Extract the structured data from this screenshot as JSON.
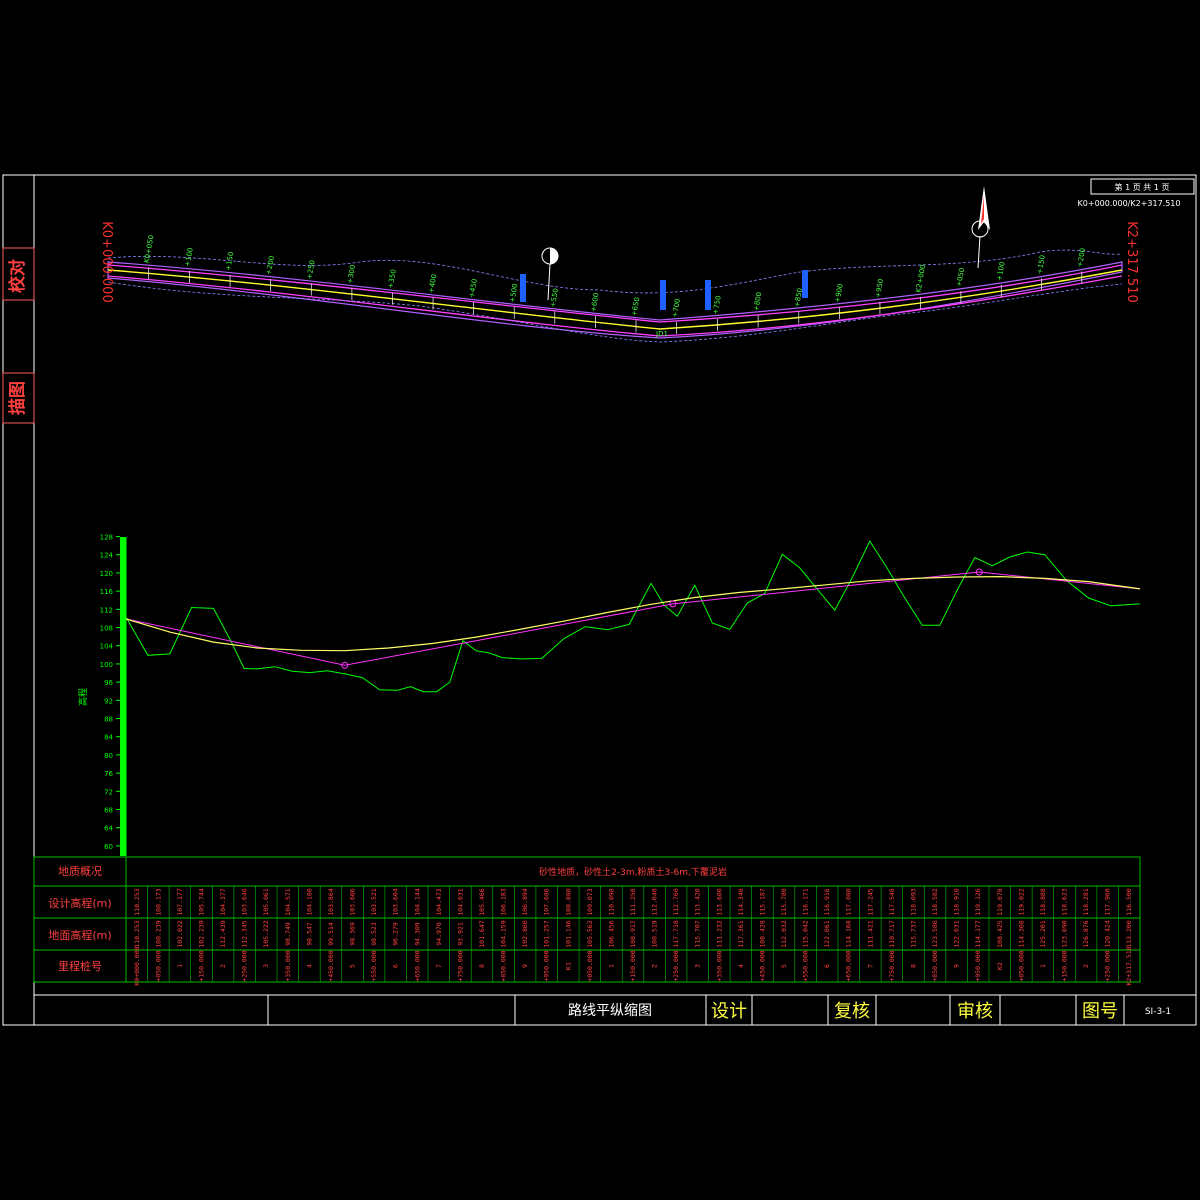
{
  "sidebar": {
    "check_label": "校对",
    "draw_label": "描图"
  },
  "header": {
    "page_info": "第 1 页 共 1 页",
    "station_range": "K0+000.000/K2+317.510"
  },
  "plan": {
    "start_label": "K0+000.000",
    "end_label": "K2+317.510",
    "curve_label": "JD1",
    "station_labels": [
      "K0+050",
      "+100",
      "+150",
      "+200",
      "+250",
      "+300",
      "+350",
      "+400",
      "+450",
      "+500",
      "+550",
      "+600",
      "+650",
      "+700",
      "+750",
      "+800",
      "+850",
      "+900",
      "+950",
      "K2+000",
      "+050",
      "+100",
      "+150",
      "+200"
    ]
  },
  "profile": {
    "axis_label": "高程",
    "y_ticks": [
      60,
      64,
      68,
      72,
      76,
      80,
      84,
      88,
      92,
      96,
      100,
      104,
      108,
      112,
      116,
      120,
      124,
      128
    ],
    "ylim": [
      58,
      129
    ],
    "xlim": [
      0,
      2317.51
    ],
    "ground": [
      [
        0,
        110.3
      ],
      [
        50,
        101.9
      ],
      [
        100,
        102.2
      ],
      [
        150,
        112.4
      ],
      [
        200,
        112.2
      ],
      [
        240,
        105
      ],
      [
        270,
        99
      ],
      [
        300,
        98.9
      ],
      [
        340,
        99.4
      ],
      [
        380,
        98.4
      ],
      [
        420,
        98.1
      ],
      [
        460,
        98.5
      ],
      [
        500,
        97.8
      ],
      [
        540,
        97
      ],
      [
        580,
        94.3
      ],
      [
        620,
        94.2
      ],
      [
        650,
        95
      ],
      [
        680,
        93.9
      ],
      [
        710,
        93.9
      ],
      [
        740,
        96
      ],
      [
        770,
        105.1
      ],
      [
        800,
        102.9
      ],
      [
        830,
        102.4
      ],
      [
        860,
        101.4
      ],
      [
        900,
        101.1
      ],
      [
        950,
        101.2
      ],
      [
        1000,
        105.5
      ],
      [
        1050,
        108.2
      ],
      [
        1100,
        107.5
      ],
      [
        1150,
        108.7
      ],
      [
        1200,
        117.7
      ],
      [
        1230,
        112.9
      ],
      [
        1260,
        110.5
      ],
      [
        1300,
        117.3
      ],
      [
        1340,
        109
      ],
      [
        1380,
        107.6
      ],
      [
        1420,
        113.4
      ],
      [
        1460,
        115.5
      ],
      [
        1500,
        124.1
      ],
      [
        1540,
        121.1
      ],
      [
        1580,
        116.4
      ],
      [
        1620,
        111.8
      ],
      [
        1660,
        119
      ],
      [
        1700,
        127
      ],
      [
        1740,
        121
      ],
      [
        1780,
        114.5
      ],
      [
        1820,
        108.5
      ],
      [
        1860,
        108.5
      ],
      [
        1900,
        116.3
      ],
      [
        1940,
        123.4
      ],
      [
        1980,
        121.6
      ],
      [
        2020,
        123.5
      ],
      [
        2060,
        124.6
      ],
      [
        2100,
        124
      ],
      [
        2150,
        118.3
      ],
      [
        2200,
        114.5
      ],
      [
        2250,
        112.8
      ],
      [
        2317,
        113.2
      ]
    ],
    "design": [
      [
        0,
        109.9
      ],
      [
        100,
        107
      ],
      [
        200,
        104.8
      ],
      [
        300,
        103.5
      ],
      [
        400,
        103
      ],
      [
        500,
        102.9
      ],
      [
        600,
        103.5
      ],
      [
        700,
        104.5
      ],
      [
        800,
        105.9
      ],
      [
        900,
        107.6
      ],
      [
        1000,
        109.4
      ],
      [
        1100,
        111.3
      ],
      [
        1200,
        113.1
      ],
      [
        1300,
        114.6
      ],
      [
        1400,
        115.7
      ],
      [
        1500,
        116.5
      ],
      [
        1600,
        117.4
      ],
      [
        1700,
        118.3
      ],
      [
        1800,
        118.8
      ],
      [
        1900,
        119.1
      ],
      [
        2000,
        119.2
      ],
      [
        2100,
        118.8
      ],
      [
        2200,
        118.1
      ],
      [
        2317.5,
        116.5
      ]
    ],
    "pvi": [
      [
        0,
        109.9
      ],
      [
        500,
        99.7
      ],
      [
        1250,
        113.2
      ],
      [
        1950,
        120.2
      ],
      [
        2317.5,
        116.5
      ]
    ]
  },
  "table": {
    "row_labels": [
      "地质概况",
      "设计高程(m)",
      "地面高程(m)",
      "里程桩号"
    ],
    "geology_text": "砂性地质，砂性土2-3m,粉质土3-6m,下覆泥岩",
    "design_elev": [
      "110.253",
      "108.173",
      "107.177",
      "105.744",
      "104.377",
      "103.646",
      "105.061",
      "104.571",
      "104.180",
      "103.864",
      "103.606",
      "103.521",
      "103.604",
      "104.144",
      "104.473",
      "104.631",
      "105.466",
      "106.183",
      "106.894",
      "107.686",
      "108.880",
      "109.073",
      "110.098",
      "111.258",
      "112.040",
      "112.760",
      "113.420",
      "113.600",
      "114.340",
      "115.187",
      "115.780",
      "116.171",
      "116.916",
      "117.080",
      "117.245",
      "117.548",
      "118.093",
      "118.582",
      "118.910",
      "119.126",
      "119.078",
      "119.022",
      "118.888",
      "118.623",
      "118.281",
      "117.960",
      "116.500"
    ],
    "ground_elev": [
      "110.253",
      "108.239",
      "102.022",
      "102.239",
      "112.439",
      "112.345",
      "105.222",
      "98.749",
      "98.547",
      "99.514",
      "98.369",
      "98.523",
      "96.279",
      "94.309",
      "94.970",
      "93.921",
      "101.647",
      "104.159",
      "102.860",
      "101.257",
      "101.146",
      "105.562",
      "106.456",
      "108.917",
      "108.519",
      "117.718",
      "115.707",
      "111.232",
      "117.361",
      "108.428",
      "112.032",
      "115.042",
      "122.061",
      "114.168",
      "111.421",
      "110.717",
      "115.737",
      "123.586",
      "122.631",
      "114.177",
      "108.425",
      "114.308",
      "125.201",
      "123.090",
      "126.876",
      "120.424",
      "113.200"
    ],
    "stations": [
      "K0+000.000",
      "+050.000",
      "1",
      "+150.000",
      "2",
      "+250.000",
      "3",
      "+350.000",
      "4",
      "+450.000",
      "5",
      "+550.000",
      "6",
      "+650.000",
      "7",
      "+750.000",
      "8",
      "+850.000",
      "9",
      "+950.000",
      "K1",
      "+050.000",
      "1",
      "+150.000",
      "2",
      "+250.000",
      "3",
      "+350.000",
      "4",
      "+450.000",
      "5",
      "+550.000",
      "6",
      "+650.000",
      "7",
      "+750.000",
      "8",
      "+850.000",
      "9",
      "+950.000",
      "K2",
      "+050.000",
      "1",
      "+150.000",
      "2",
      "+250.000",
      "K2+317.510"
    ]
  },
  "title_block": {
    "drawing_title": "路线平纵缩图",
    "design_label": "设计",
    "review_label": "复核",
    "approve_label": "审核",
    "number_label": "图号",
    "drawing_number": "SI-3-1"
  },
  "colors": {
    "frame": "#ffffff",
    "table_lines": "#00c000",
    "ground_line": "#00ff00",
    "design_line": "#ffff66",
    "grade_line": "#ff33ff",
    "red_text": "#ff3030",
    "yellow_text": "#ffff40",
    "axis": "#00ff00"
  }
}
